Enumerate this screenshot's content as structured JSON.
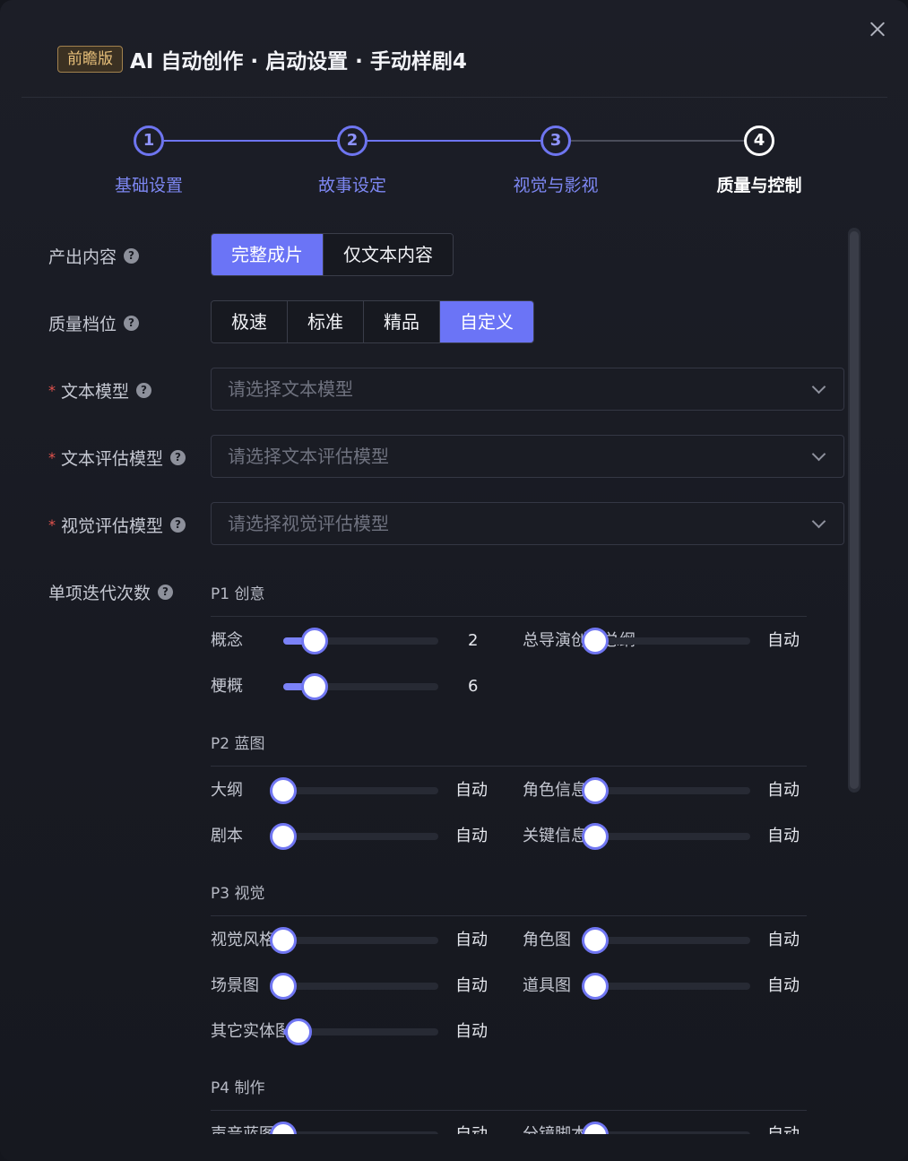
{
  "dialog": {
    "badge": "前瞻版",
    "title": "AI 自动创作 · 启动设置 · 手动样剧4"
  },
  "steps": [
    {
      "number": "1",
      "label": "基础设置"
    },
    {
      "number": "2",
      "label": "故事设定"
    },
    {
      "number": "3",
      "label": "视觉与影视"
    },
    {
      "number": "4",
      "label": "质量与控制"
    }
  ],
  "form": {
    "output": {
      "label": "产出内容",
      "options": [
        "完整成片",
        "仅文本内容"
      ],
      "selected": "完整成片"
    },
    "quality": {
      "label": "质量档位",
      "options": [
        "极速",
        "标准",
        "精品",
        "自定义"
      ],
      "selected": "自定义"
    },
    "text_model": {
      "label": "文本模型",
      "placeholder": "请选择文本模型"
    },
    "text_eval_model": {
      "label": "文本评估模型",
      "placeholder": "请选择文本评估模型"
    },
    "visual_eval_model": {
      "label": "视觉评估模型",
      "placeholder": "请选择视觉评估模型"
    },
    "iterations": {
      "label": "单项迭代次数",
      "groups": [
        {
          "title": "P1 创意",
          "items": [
            {
              "label": "概念",
              "value": "2",
              "fraction": 0.2
            },
            {
              "label": "总导演创作总纲",
              "value": "自动",
              "fraction": 0
            },
            {
              "label": "梗概",
              "value": "6",
              "fraction": 0.2
            }
          ]
        },
        {
          "title": "P2 蓝图",
          "items": [
            {
              "label": "大纲",
              "value": "自动",
              "fraction": 0
            },
            {
              "label": "角色信息",
              "value": "自动",
              "fraction": 0
            },
            {
              "label": "剧本",
              "value": "自动",
              "fraction": 0
            },
            {
              "label": "关键信息",
              "value": "自动",
              "fraction": 0
            }
          ]
        },
        {
          "title": "P3 视觉",
          "items": [
            {
              "label": "视觉风格",
              "value": "自动",
              "fraction": 0
            },
            {
              "label": "角色图",
              "value": "自动",
              "fraction": 0
            },
            {
              "label": "场景图",
              "value": "自动",
              "fraction": 0
            },
            {
              "label": "道具图",
              "value": "自动",
              "fraction": 0
            },
            {
              "label": "其它实体图",
              "value": "自动",
              "fraction": 0.1
            }
          ]
        },
        {
          "title": "P4 制作",
          "items": [
            {
              "label": "声音蓝图",
              "value": "自动",
              "fraction": 0
            },
            {
              "label": "分镜脚本",
              "value": "自动",
              "fraction": 0
            }
          ]
        }
      ]
    }
  },
  "colors": {
    "accent": "#6b74f6",
    "badge_text": "#e7bf7a",
    "required": "#e5544e"
  }
}
